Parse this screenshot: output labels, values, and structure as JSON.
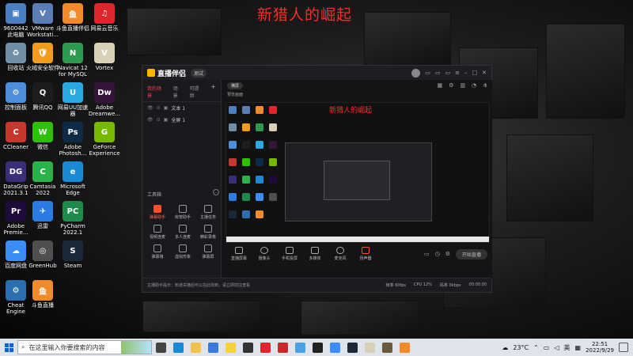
{
  "overlay_title": "新猎人的崛起",
  "desktop_icons": [
    {
      "label": "9600442\n此电脑",
      "icon": "computer-icon",
      "color": "#4a7fc1",
      "glyph": "▣"
    },
    {
      "label": "VMware\nWorkstati...",
      "icon": "vmware-icon",
      "color": "#5b7fb5",
      "glyph": "V"
    },
    {
      "label": "斗鱼直播伴侣",
      "icon": "douyu-companion-icon",
      "color": "#f08a2a",
      "glyph": "鱼"
    },
    {
      "label": "网易云音乐",
      "icon": "netease-music-icon",
      "color": "#e0262d",
      "glyph": "♫"
    },
    {
      "label": "回收站",
      "icon": "recycle-bin-icon",
      "color": "#6f8ea8",
      "glyph": "♻"
    },
    {
      "label": "火绒安全软件",
      "icon": "huorong-icon",
      "color": "#f29b1d",
      "glyph": "🛡"
    },
    {
      "label": "Navicat 12\nfor MySQL",
      "icon": "navicat-icon",
      "color": "#2e9a4f",
      "glyph": "N"
    },
    {
      "label": "Vortex",
      "icon": "vortex-icon",
      "color": "#d9d0b8",
      "glyph": "V"
    },
    {
      "label": "控制面板",
      "icon": "control-panel-icon",
      "color": "#4c8ed9",
      "glyph": "⚙"
    },
    {
      "label": "腾讯QQ",
      "icon": "qq-icon",
      "color": "#1d1d1d",
      "glyph": "Q"
    },
    {
      "label": "网易UU加速\n器",
      "icon": "uu-accelerator-icon",
      "color": "#2aa9e0",
      "glyph": "U"
    },
    {
      "label": "Adobe\nDreamwe...",
      "icon": "dreamweaver-icon",
      "color": "#35143a",
      "glyph": "Dw"
    },
    {
      "label": "CCleaner",
      "icon": "ccleaner-icon",
      "color": "#c8372d",
      "glyph": "C"
    },
    {
      "label": "微信",
      "icon": "wechat-icon",
      "color": "#2dc100",
      "glyph": "W"
    },
    {
      "label": "Adobe\nPhotosh...",
      "icon": "photoshop-icon",
      "color": "#0e2a47",
      "glyph": "Ps"
    },
    {
      "label": "GeForce\nExperience",
      "icon": "geforce-icon",
      "color": "#76b900",
      "glyph": "G"
    },
    {
      "label": "DataGrip\n2021.3.1",
      "icon": "datagrip-icon",
      "color": "#3b2d7a",
      "glyph": "DG"
    },
    {
      "label": "Camtasia\n2022",
      "icon": "camtasia-icon",
      "color": "#2bb24c",
      "glyph": "C"
    },
    {
      "label": "Microsoft\nEdge",
      "icon": "edge-icon",
      "color": "#1a8ad4",
      "glyph": "e"
    },
    {
      "label": "Adobe\nPremie...",
      "icon": "premiere-icon",
      "color": "#1f0a3c",
      "glyph": "Pr"
    },
    {
      "label": "迅雷",
      "icon": "xunlei-icon",
      "color": "#2c7be5",
      "glyph": "✈"
    },
    {
      "label": "PyCharm\n2022.1",
      "icon": "pycharm-icon",
      "color": "#1e8a4c",
      "glyph": "PC"
    },
    {
      "label": "百度网盘",
      "icon": "baidu-netdisk-icon",
      "color": "#3b8cf5",
      "glyph": "☁"
    },
    {
      "label": "GreenHub",
      "icon": "greenhub-icon",
      "color": "#4f4f4f",
      "glyph": "◎"
    },
    {
      "label": "Steam",
      "icon": "steam-icon",
      "color": "#1b2838",
      "glyph": "S"
    },
    {
      "label": "Cheat\nEngine",
      "icon": "cheat-engine-icon",
      "color": "#2b6fb3",
      "glyph": "⚙"
    },
    {
      "label": "斗鱼直播",
      "icon": "douyu-icon",
      "color": "#f08a2a",
      "glyph": "鱼"
    }
  ],
  "app": {
    "title": "直播伴侣",
    "badge": "测试",
    "tabs": [
      "我的场景",
      "场景",
      "可提供"
    ],
    "add": "+",
    "scenes": [
      {
        "name": "文本 1",
        "eye": "👁"
      },
      {
        "name": "全屏 1",
        "eye": "👁"
      }
    ],
    "tools_title": "工具箱",
    "tools_more": "…",
    "tools": [
      {
        "label": "弹幕助手",
        "active": true
      },
      {
        "label": "房管助手",
        "active": false
      },
      {
        "label": "主播任务",
        "active": false
      },
      {
        "label": "视频连麦",
        "active": false
      },
      {
        "label": "多人连麦",
        "active": false
      },
      {
        "label": "精彩录像",
        "active": false
      },
      {
        "label": "弹幕墙",
        "active": false
      },
      {
        "label": "虚拟形象",
        "active": false
      },
      {
        "label": "弹幕屏",
        "active": false
      }
    ],
    "scene_pill": "横屏",
    "preview_sub": "预览画面",
    "controls": [
      "直播屏幕",
      "摄像头",
      "手机投屏",
      "多媒体",
      "麦克风",
      "扬声器"
    ],
    "start_live": "开始直播",
    "status_left": "主播助手提示：知道关播后可以在此找到，请立即前往查看",
    "status_fps": "帧率 60fps",
    "status_cpu": "CPU 12%",
    "status_net": "码率 0kbps",
    "status_time": "00:00:00"
  },
  "taskbar": {
    "search_placeholder": "在这里输入你要搜索的内容",
    "weather": "23°C",
    "lang": "英",
    "time": "22:51",
    "date": "2022/9/29",
    "apps": [
      {
        "name": "task-view-icon",
        "color": "#444"
      },
      {
        "name": "edge-taskbar-icon",
        "color": "#1a8ad4"
      },
      {
        "name": "file-explorer-icon",
        "color": "#f2c14e"
      },
      {
        "name": "mail-icon",
        "color": "#3b7ad6"
      },
      {
        "name": "sticky-notes-icon",
        "color": "#f4d23c"
      },
      {
        "name": "alienware-icon",
        "color": "#333"
      },
      {
        "name": "music-icon",
        "color": "#e0262d"
      },
      {
        "name": "netease-taskbar-icon",
        "color": "#c72a2a"
      },
      {
        "name": "browser-icon",
        "color": "#4aa0e0"
      },
      {
        "name": "qq-taskbar-icon",
        "color": "#222"
      },
      {
        "name": "baidu-taskbar-icon",
        "color": "#3b8cf5"
      },
      {
        "name": "steam-taskbar-icon",
        "color": "#1b2838"
      },
      {
        "name": "vortex-taskbar-icon",
        "color": "#d9d0b8"
      },
      {
        "name": "game-icon",
        "color": "#6a5a3a"
      },
      {
        "name": "douyu-taskbar-icon",
        "color": "#f08a2a"
      }
    ]
  }
}
